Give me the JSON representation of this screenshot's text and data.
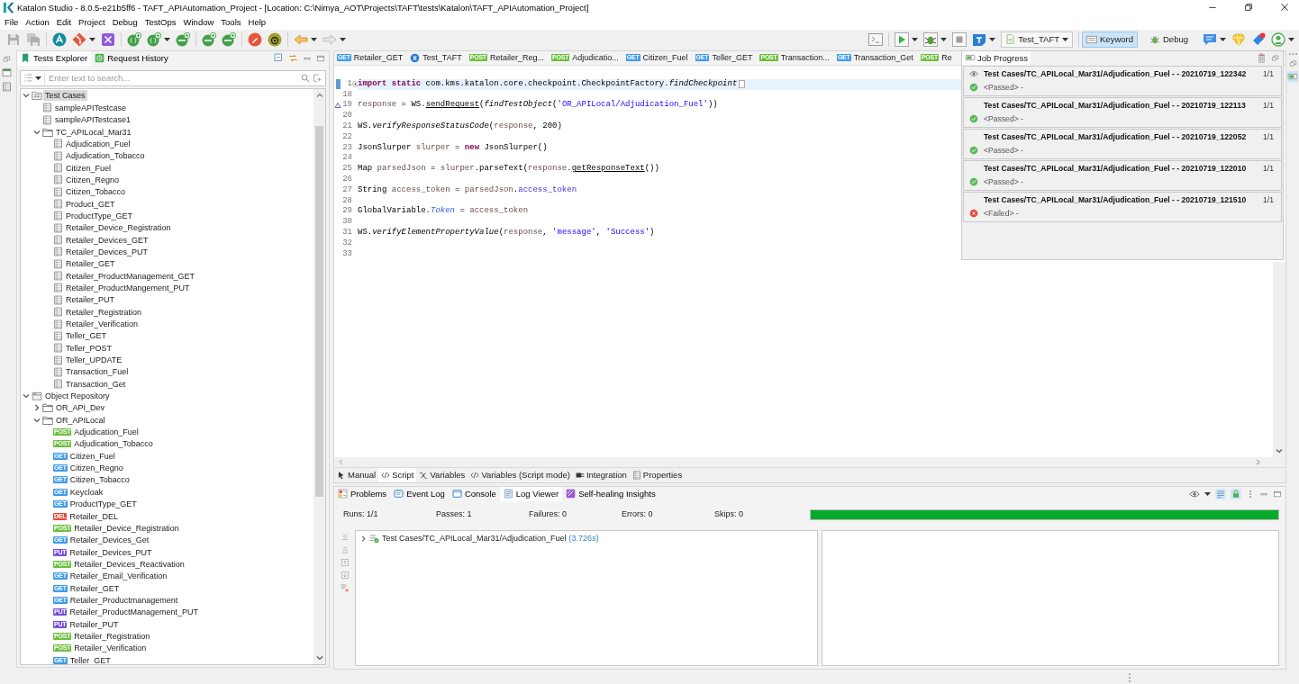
{
  "window": {
    "title": "Katalon Studio - 8.0.5-e21b5ff6 - TAFT_APIAutomation_Project - [Location: C:\\Nimya_AOT\\Projects\\TAFT\\tests\\Katalon\\TAFT_APIAutomation_Project]"
  },
  "menu": [
    "File",
    "Action",
    "Edit",
    "Project",
    "Debug",
    "TestOps",
    "Window",
    "Tools",
    "Help"
  ],
  "toolbar": {
    "profile": "Test_TAFT",
    "modes": [
      {
        "label": "Keyword",
        "selected": true
      },
      {
        "label": "Debug",
        "selected": false
      }
    ]
  },
  "explorer": {
    "tabs": [
      {
        "label": "Tests Explorer",
        "selected": true
      },
      {
        "label": "Request History",
        "selected": false
      }
    ],
    "search": {
      "placeholder": "Enter text to search..."
    },
    "tree": [
      {
        "label": "Test Cases",
        "kind": "test-root",
        "expanded": true,
        "selected": true,
        "children": [
          {
            "label": "sampleAPITestcase",
            "kind": "test-case",
            "selected": false
          },
          {
            "label": "sampleAPITestcase1",
            "kind": "test-case",
            "selected": false
          },
          {
            "label": "TC_APILocal_Mar31",
            "kind": "folder",
            "expanded": true,
            "selected": false,
            "children": [
              {
                "label": "Adjudication_Fuel",
                "kind": "test-case",
                "selected": false
              },
              {
                "label": "Adjudication_Tobacco",
                "kind": "test-case",
                "selected": false
              },
              {
                "label": "Citizen_Fuel",
                "kind": "test-case",
                "selected": false
              },
              {
                "label": "Citizen_Regno",
                "kind": "test-case",
                "selected": false
              },
              {
                "label": "Citizen_Tobacco",
                "kind": "test-case",
                "selected": false
              },
              {
                "label": "Product_GET",
                "kind": "test-case",
                "selected": false
              },
              {
                "label": "ProductType_GET",
                "kind": "test-case",
                "selected": false
              },
              {
                "label": "Retailer_Device_Registration",
                "kind": "test-case",
                "selected": false
              },
              {
                "label": "Retailer_Devices_GET",
                "kind": "test-case",
                "selected": false
              },
              {
                "label": "Retailer_Devices_PUT",
                "kind": "test-case",
                "selected": false
              },
              {
                "label": "Retailer_GET",
                "kind": "test-case",
                "selected": false
              },
              {
                "label": "Retailer_ProductManagement_GET",
                "kind": "test-case",
                "selected": false
              },
              {
                "label": "Retailer_ProductMangement_PUT",
                "kind": "test-case",
                "selected": false
              },
              {
                "label": "Retailer_PUT",
                "kind": "test-case",
                "selected": false
              },
              {
                "label": "Retailer_Registration",
                "kind": "test-case",
                "selected": false
              },
              {
                "label": "Retailer_Verification",
                "kind": "test-case",
                "selected": false
              },
              {
                "label": "Teller_GET",
                "kind": "test-case",
                "selected": false
              },
              {
                "label": "Teller_POST",
                "kind": "test-case",
                "selected": false
              },
              {
                "label": "Teller_UPDATE",
                "kind": "test-case",
                "selected": false
              },
              {
                "label": "Transaction_Fuel",
                "kind": "test-case",
                "selected": false
              },
              {
                "label": "Transaction_Get",
                "kind": "test-case",
                "selected": false
              }
            ]
          }
        ]
      },
      {
        "label": "Object Repository",
        "kind": "repository-root",
        "expanded": true,
        "selected": false,
        "children": [
          {
            "label": "OR_API_Dev",
            "kind": "folder",
            "expanded": false,
            "selected": false
          },
          {
            "label": "OR_APILocal",
            "kind": "folder",
            "expanded": true,
            "selected": false,
            "children": [
              {
                "label": "Adjudication_Fuel",
                "kind": "request",
                "method": "POST",
                "color": "#6dbf3e",
                "selected": false
              },
              {
                "label": "Adjudication_Tobacco",
                "kind": "request",
                "method": "POST",
                "color": "#6dbf3e",
                "selected": false
              },
              {
                "label": "Citizen_Fuel",
                "kind": "request",
                "method": "GET",
                "color": "#3d9be9",
                "selected": false
              },
              {
                "label": "Citizen_Regno",
                "kind": "request",
                "method": "GET",
                "color": "#3d9be9",
                "selected": false
              },
              {
                "label": "Citizen_Tobacco",
                "kind": "request",
                "method": "GET",
                "color": "#3d9be9",
                "selected": false
              },
              {
                "label": "Keycloak",
                "kind": "request",
                "method": "GET",
                "color": "#3d9be9",
                "selected": false
              },
              {
                "label": "ProductType_GET",
                "kind": "request",
                "method": "GET",
                "color": "#3d9be9",
                "selected": false
              },
              {
                "label": "Retailer_DEL",
                "kind": "request",
                "method": "DEL",
                "color": "#e2483a",
                "selected": false
              },
              {
                "label": "Retailer_Device_Registration",
                "kind": "request",
                "method": "POST",
                "color": "#6dbf3e",
                "selected": false
              },
              {
                "label": "Retailer_Devices_Get",
                "kind": "request",
                "method": "GET",
                "color": "#3d9be9",
                "selected": false
              },
              {
                "label": "Retailer_Devices_PUT",
                "kind": "request",
                "method": "PUT",
                "color": "#7a4fd9",
                "selected": false
              },
              {
                "label": "Retailer_Devices_Reactivation",
                "kind": "request",
                "method": "POST",
                "color": "#6dbf3e",
                "selected": false
              },
              {
                "label": "Retailer_Email_Verification",
                "kind": "request",
                "method": "GET",
                "color": "#3d9be9",
                "selected": false
              },
              {
                "label": "Retailer_GET",
                "kind": "request",
                "method": "GET",
                "color": "#3d9be9",
                "selected": false
              },
              {
                "label": "Retailer_Productmanagement",
                "kind": "request",
                "method": "GET",
                "color": "#3d9be9",
                "selected": false
              },
              {
                "label": "Retailer_ProductManagement_PUT",
                "kind": "request",
                "method": "PUT",
                "color": "#7a4fd9",
                "selected": false
              },
              {
                "label": "Retailer_PUT",
                "kind": "request",
                "method": "PUT",
                "color": "#7a4fd9",
                "selected": false
              },
              {
                "label": "Retailer_Registration",
                "kind": "request",
                "method": "POST",
                "color": "#6dbf3e",
                "selected": false
              },
              {
                "label": "Retailer_Verification",
                "kind": "request",
                "method": "POST",
                "color": "#6dbf3e",
                "selected": false
              },
              {
                "label": "Teller_GET",
                "kind": "request",
                "method": "GET",
                "color": "#3d9be9",
                "selected": false
              }
            ]
          }
        ]
      }
    ]
  },
  "editor": {
    "tabs": [
      {
        "label": "Retailer_GET",
        "kind": "request",
        "method": "GET",
        "color": "#3d9be9"
      },
      {
        "label": "Test_TAFT",
        "kind": "collection"
      },
      {
        "label": "Retailer_Reg...",
        "kind": "request",
        "method": "POST",
        "color": "#6dbf3e"
      },
      {
        "label": "Adjudicatio...",
        "kind": "request",
        "method": "POST",
        "color": "#6dbf3e"
      },
      {
        "label": "Citizen_Fuel",
        "kind": "request",
        "method": "GET",
        "color": "#3d9be9"
      },
      {
        "label": "Teller_GET",
        "kind": "request",
        "method": "GET",
        "color": "#3d9be9"
      },
      {
        "label": "Transaction...",
        "kind": "request",
        "method": "POST",
        "color": "#6dbf3e"
      },
      {
        "label": "Transaction_Get",
        "kind": "request",
        "method": "GET",
        "color": "#3d9be9"
      },
      {
        "label": "Re",
        "kind": "request",
        "method": "POST",
        "color": "#6dbf3e"
      }
    ],
    "lines": [
      {
        "number": "1",
        "kind": "folded",
        "current": true,
        "tokens": [
          {
            "kind": "keyword",
            "text": "import static"
          },
          {
            "kind": "plain",
            "text": " com.kms.katalon.core.checkpoint.CheckpointFactory."
          },
          {
            "kind": "method",
            "text": "findCheckpoint"
          }
        ]
      },
      {
        "number": "18",
        "kind": "blank",
        "current": false
      },
      {
        "number": "19",
        "kind": "override",
        "current": false,
        "tokens": [
          {
            "kind": "local",
            "text": "response"
          },
          {
            "kind": "plain",
            "text": " = WS."
          },
          {
            "kind": "call",
            "text": "sendRequest"
          },
          {
            "kind": "plain",
            "text": "("
          },
          {
            "kind": "method",
            "text": "findTestObject"
          },
          {
            "kind": "plain",
            "text": "("
          },
          {
            "kind": "string",
            "text": "'OR_APILocal/Adjudication_Fuel'"
          },
          {
            "kind": "plain",
            "text": "))"
          }
        ]
      },
      {
        "number": "20",
        "kind": "blank",
        "current": false
      },
      {
        "number": "21",
        "kind": "code",
        "current": false,
        "tokens": [
          {
            "kind": "plain",
            "text": "WS."
          },
          {
            "kind": "method",
            "text": "verifyResponseStatusCode"
          },
          {
            "kind": "plain",
            "text": "("
          },
          {
            "kind": "local",
            "text": "response"
          },
          {
            "kind": "plain",
            "text": ", 200)"
          }
        ]
      },
      {
        "number": "22",
        "kind": "blank",
        "current": false
      },
      {
        "number": "23",
        "kind": "code",
        "current": false,
        "tokens": [
          {
            "kind": "plain",
            "text": "JsonSlurper "
          },
          {
            "kind": "local",
            "text": "slurper"
          },
          {
            "kind": "plain",
            "text": " = "
          },
          {
            "kind": "keyword",
            "text": "new"
          },
          {
            "kind": "plain",
            "text": " JsonSlurper()"
          }
        ]
      },
      {
        "number": "24",
        "kind": "blank",
        "current": false
      },
      {
        "number": "25",
        "kind": "code",
        "current": false,
        "tokens": [
          {
            "kind": "plain",
            "text": "Map "
          },
          {
            "kind": "local",
            "text": "parsedJson"
          },
          {
            "kind": "plain",
            "text": " = "
          },
          {
            "kind": "local",
            "text": "slurper"
          },
          {
            "kind": "plain",
            "text": ".parseText("
          },
          {
            "kind": "local",
            "text": "response"
          },
          {
            "kind": "plain",
            "text": "."
          },
          {
            "kind": "call",
            "text": "getResponseText"
          },
          {
            "kind": "plain",
            "text": "())"
          }
        ]
      },
      {
        "number": "26",
        "kind": "blank",
        "current": false
      },
      {
        "number": "27",
        "kind": "code",
        "current": false,
        "tokens": [
          {
            "kind": "plain",
            "text": "String "
          },
          {
            "kind": "local",
            "text": "access_token"
          },
          {
            "kind": "plain",
            "text": " = "
          },
          {
            "kind": "local",
            "text": "parsedJson"
          },
          {
            "kind": "plain",
            "text": "."
          },
          {
            "kind": "field",
            "text": "access_token"
          }
        ]
      },
      {
        "number": "28",
        "kind": "blank",
        "current": false
      },
      {
        "number": "29",
        "kind": "code",
        "current": false,
        "tokens": [
          {
            "kind": "plain",
            "text": "GlobalVariable."
          },
          {
            "kind": "static",
            "text": "Token"
          },
          {
            "kind": "plain",
            "text": " = "
          },
          {
            "kind": "local",
            "text": "access_token"
          }
        ]
      },
      {
        "number": "30",
        "kind": "blank",
        "current": false
      },
      {
        "number": "31",
        "kind": "code",
        "current": false,
        "tokens": [
          {
            "kind": "plain",
            "text": "WS."
          },
          {
            "kind": "method",
            "text": "verifyElementPropertyValue"
          },
          {
            "kind": "plain",
            "text": "("
          },
          {
            "kind": "local",
            "text": "response"
          },
          {
            "kind": "plain",
            "text": ", "
          },
          {
            "kind": "string",
            "text": "'message'"
          },
          {
            "kind": "plain",
            "text": ", "
          },
          {
            "kind": "string",
            "text": "'Success'"
          },
          {
            "kind": "plain",
            "text": ")"
          }
        ]
      },
      {
        "number": "32",
        "kind": "blank",
        "current": false
      },
      {
        "number": "33",
        "kind": "blank",
        "current": false
      }
    ],
    "views": [
      {
        "label": "Manual",
        "selected": false
      },
      {
        "label": "Script",
        "selected": true
      },
      {
        "label": "Variables",
        "selected": false
      },
      {
        "label": "Variables (Script mode)",
        "selected": false
      },
      {
        "label": "Integration",
        "selected": false
      },
      {
        "label": "Properties",
        "selected": false
      }
    ]
  },
  "job_progress": {
    "title": "Job Progress",
    "open": true,
    "jobs": [
      {
        "name": "Test Cases/TC_APILocal_Mar31/Adjudication_Fuel - - 20210719_122342",
        "count": "1/1",
        "status": "<Passed> -",
        "kind": "passed",
        "watched": true
      },
      {
        "name": "Test Cases/TC_APILocal_Mar31/Adjudication_Fuel - - 20210719_122113",
        "count": "1/1",
        "status": "<Passed> -",
        "kind": "passed",
        "watched": false
      },
      {
        "name": "Test Cases/TC_APILocal_Mar31/Adjudication_Fuel - - 20210719_122052",
        "count": "1/1",
        "status": "<Passed> -",
        "kind": "passed",
        "watched": false
      },
      {
        "name": "Test Cases/TC_APILocal_Mar31/Adjudication_Fuel - - 20210719_122010",
        "count": "1/1",
        "status": "<Passed> -",
        "kind": "passed",
        "watched": false
      },
      {
        "name": "Test Cases/TC_APILocal_Mar31/Adjudication_Fuel - - 20210719_121510",
        "count": "1/1",
        "status": "<Failed> -",
        "kind": "failed",
        "watched": false
      }
    ]
  },
  "log_viewer": {
    "tabs": [
      {
        "label": "Problems",
        "selected": false
      },
      {
        "label": "Event Log",
        "selected": false
      },
      {
        "label": "Console",
        "selected": false
      },
      {
        "label": "Log Viewer",
        "selected": true
      },
      {
        "label": "Self-healing Insights",
        "selected": false
      }
    ],
    "stats": [
      "Runs: 1/1",
      "Passes: 1",
      "Failures: 0",
      "Errors: 0",
      "Skips: 0"
    ],
    "progress": {
      "level": 1
    },
    "results": [
      {
        "label": "Test Cases/TC_APILocal_Mar31/Adjudication_Fuel",
        "duration": "(3.726s)",
        "expanded": false
      }
    ]
  }
}
